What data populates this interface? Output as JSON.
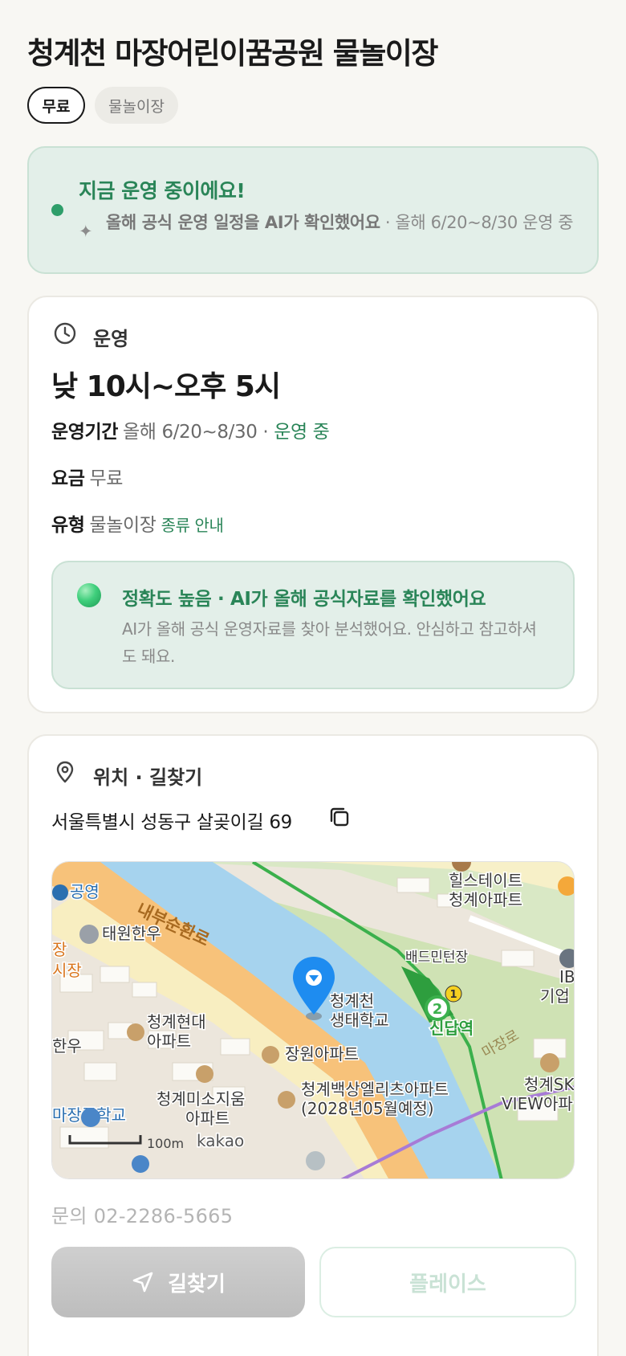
{
  "header": {
    "title": "청계천 마장어린이꿈공원 물놀이장",
    "chips": {
      "fee": "무료",
      "type": "물놀이장"
    }
  },
  "status": {
    "title": "지금 운영 중이에요!",
    "desc_bold": "올해 공식 운영 일정을 AI가 확인했어요",
    "desc_rest": " · 올해 6/20~8/30 운영 중",
    "dot_color": "#2e9e6a"
  },
  "operation": {
    "label": "운영",
    "hours": "낮 10시~오후 5시",
    "period_key": "운영기간",
    "period_value": "올해 6/20~8/30 · ",
    "period_status": "운영 중",
    "fee_key": "요금",
    "fee_value": "무료",
    "type_key": "유형",
    "type_value": "물놀이장",
    "type_guide": "종류 안내",
    "accuracy": {
      "title": "정확도 높음 · AI가 올해 공식자료를 확인했어요",
      "desc": "AI가 올해 공식 운영자료를 찾아 분석했어요. 안심하고 참고하셔도 돼요."
    }
  },
  "location": {
    "label": "위치 · 길찾기",
    "address": "서울특별시 성동구 살곶이길 69",
    "contact": "문의 02-2286-5665",
    "map": {
      "labels": {
        "hills": "힐스테이트",
        "hills2": "청계아파트",
        "gongyeong": "공영",
        "naebu": "내부순환로",
        "taewon": "태원한우",
        "market1": "장",
        "market2": "시장",
        "badminton": "배드민턴장",
        "ib1": "IB",
        "ib2": "기업",
        "school1": "청계천",
        "school2": "생태학교",
        "station": "신답역",
        "station_line": "2",
        "station_line2": "1",
        "majang_ro": "마장로",
        "hyundai1": "청계현대",
        "hyundai2": "아파트",
        "hanu": "한우",
        "jangwon": "장원아파트",
        "misoji1": "청계미소지움",
        "misoji2": "아파트",
        "baeksang1": "청계백상엘리츠아파트",
        "baeksang2": "(2028년05월예정)",
        "sk1": "청계SK",
        "sk2": "VIEW아파",
        "majang_school": "마장중학교",
        "scale": "100m",
        "brand": "kakao"
      }
    }
  },
  "buttons": {
    "navigate": "길찾기",
    "place": "플레이스"
  }
}
